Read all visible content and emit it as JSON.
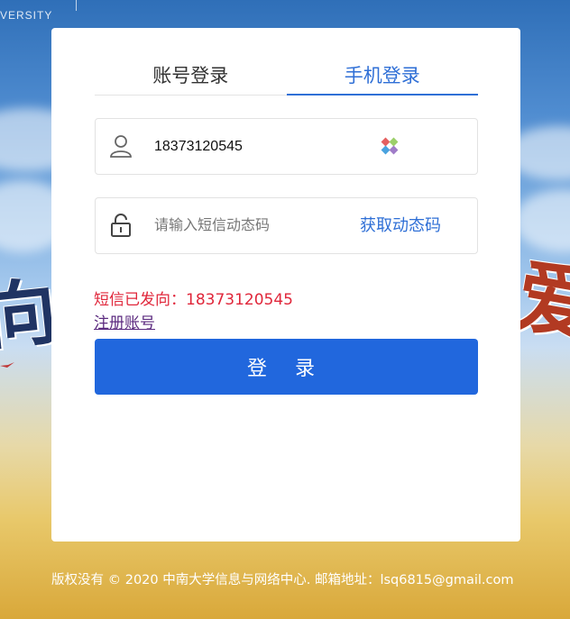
{
  "header": {
    "brand_text": "VERSITY"
  },
  "decor": {
    "left_glyph": "向",
    "right_glyph": "爱"
  },
  "tabs": [
    {
      "label": "账号登录",
      "active": false
    },
    {
      "label": "手机登录",
      "active": true
    }
  ],
  "phone_field": {
    "value": "18373120545",
    "icon": "user-icon",
    "clear_icon": "clear-icon"
  },
  "code_field": {
    "value": "",
    "placeholder": "请输入短信动态码",
    "icon": "lock-icon",
    "get_code_label": "获取动态码"
  },
  "sms_status": "短信已发向：18373120545",
  "register_label": "注册账号",
  "login_label": "登 录",
  "footer": "版权没有 © 2020 中南大学信息与网络中心. 邮箱地址：lsq6815@gmail.com",
  "colors": {
    "accent": "#2167dd",
    "tab_active": "#2f6fd6",
    "error": "#e0263a",
    "visited_link": "#5b2a7f"
  }
}
